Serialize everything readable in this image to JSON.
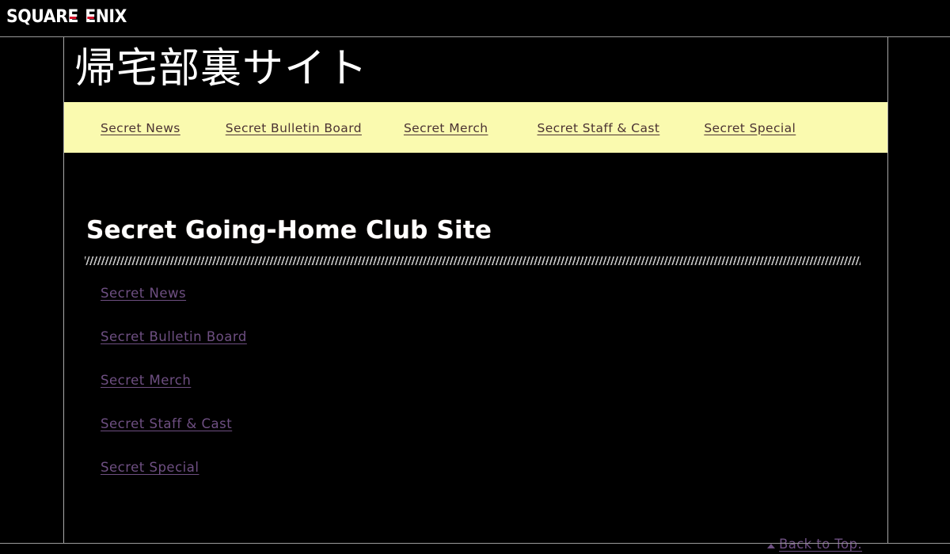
{
  "brand": {
    "logo_text": "SQUARE ENIX",
    "logo_part1": "SQUAR",
    "logo_part1_e": "E",
    "logo_part2_e": "E",
    "logo_part2": "NIX",
    "accent_color": "#d8122b",
    "text_color": "#ffffff"
  },
  "header": {
    "site_title": "帰宅部裏サイト",
    "title_color": "#ffffff"
  },
  "nav": {
    "background_color": "#fafaaf",
    "link_color": "#4b3333",
    "items": [
      {
        "label": "Secret News",
        "name": "nav-secret-news"
      },
      {
        "label": "Secret Bulletin Board",
        "name": "nav-secret-bulletin-board"
      },
      {
        "label": "Secret Merch",
        "name": "nav-secret-merch"
      },
      {
        "label": "Secret Staff & Cast",
        "name": "nav-secret-staff-and-cast"
      },
      {
        "label": "Secret Special",
        "name": "nav-secret-special"
      }
    ]
  },
  "main": {
    "heading": "Secret Going-Home Club Site",
    "heading_color": "#ffffff",
    "link_color": "#6e4f82",
    "links": [
      {
        "label": "Secret News",
        "name": "content-link-secret-news"
      },
      {
        "label": "Secret Bulletin Board",
        "name": "content-link-secret-bulletin-board"
      },
      {
        "label": "Secret Merch",
        "name": "content-link-secret-merch"
      },
      {
        "label": "Secret Staff & Cast",
        "name": "content-link-secret-staff-and-cast"
      },
      {
        "label": "Secret Special",
        "name": "content-link-secret-special"
      }
    ]
  },
  "footer": {
    "back_to_top_label": "Back to Top.",
    "back_to_top_icon": "triangle-up-icon"
  },
  "page": {
    "background_color": "#000000",
    "frame_border_color": "#a8a8a8"
  }
}
